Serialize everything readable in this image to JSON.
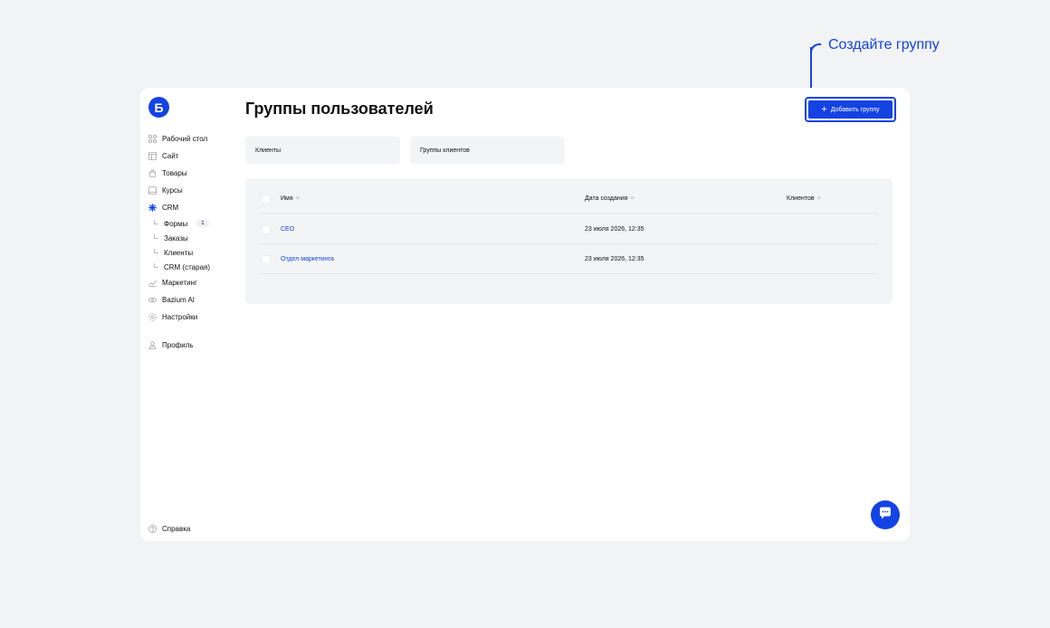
{
  "callout": {
    "text": "Создайте группу"
  },
  "logo": {
    "letter": "Б"
  },
  "sidebar": {
    "items": [
      {
        "label": "Рабочий стол",
        "icon": "dashboard-icon"
      },
      {
        "label": "Сайт",
        "icon": "site-icon"
      },
      {
        "label": "Товары",
        "icon": "bag-icon"
      },
      {
        "label": "Курсы",
        "icon": "courses-icon"
      },
      {
        "label": "CRM",
        "icon": "crm-icon"
      },
      {
        "label": "Маркетинг",
        "icon": "marketing-icon"
      },
      {
        "label": "Bazium AI",
        "icon": "ai-icon"
      },
      {
        "label": "Настройки",
        "icon": "gear-icon"
      }
    ],
    "crm_sub": [
      {
        "label": "Формы",
        "badge": "1"
      },
      {
        "label": "Заказы"
      },
      {
        "label": "Клиенты"
      },
      {
        "label": "CRM (старая)"
      }
    ],
    "profile": "Профиль",
    "help": "Справка"
  },
  "page": {
    "title": "Группы пользователей",
    "add_button": "Добавить группу",
    "add_button_icon": "+"
  },
  "tabs": [
    {
      "label": "Клиенты"
    },
    {
      "label": "Группы клиентов"
    }
  ],
  "table": {
    "columns": [
      "Имя",
      "Дата создания",
      "Клиентов"
    ],
    "sort_glyph": "≡",
    "rows": [
      {
        "name": "CEO",
        "created": "23 июля 2026, 12:35",
        "clients": ""
      },
      {
        "name": "Отдел маркетинга",
        "created": "23 июля 2026, 12:35",
        "clients": ""
      }
    ]
  },
  "colors": {
    "accent": "#1443e3",
    "background": "#f2f3f5",
    "card": "#ffffff",
    "panel": "#f3f4f6"
  }
}
